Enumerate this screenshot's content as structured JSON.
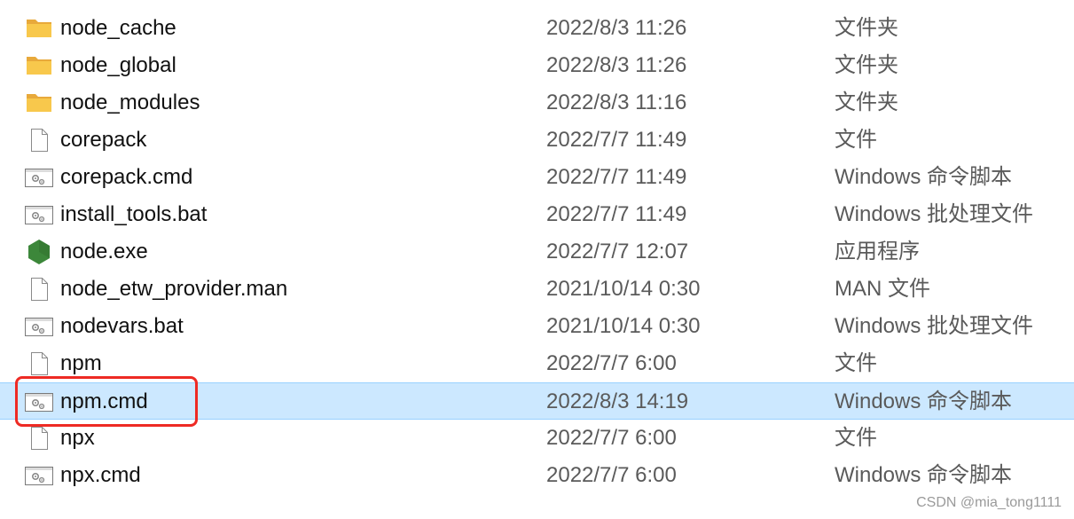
{
  "files": [
    {
      "name": "node_cache",
      "date": "2022/8/3 11:26",
      "type": "文件夹",
      "icon": "folder-icon"
    },
    {
      "name": "node_global",
      "date": "2022/8/3 11:26",
      "type": "文件夹",
      "icon": "folder-icon"
    },
    {
      "name": "node_modules",
      "date": "2022/8/3 11:16",
      "type": "文件夹",
      "icon": "folder-icon"
    },
    {
      "name": "corepack",
      "date": "2022/7/7 11:49",
      "type": "文件",
      "icon": "file-icon"
    },
    {
      "name": "corepack.cmd",
      "date": "2022/7/7 11:49",
      "type": "Windows 命令脚本",
      "icon": "script-icon"
    },
    {
      "name": "install_tools.bat",
      "date": "2022/7/7 11:49",
      "type": "Windows 批处理文件",
      "icon": "script-icon"
    },
    {
      "name": "node.exe",
      "date": "2022/7/7 12:07",
      "type": "应用程序",
      "icon": "nodejs-icon"
    },
    {
      "name": "node_etw_provider.man",
      "date": "2021/10/14 0:30",
      "type": "MAN 文件",
      "icon": "file-icon"
    },
    {
      "name": "nodevars.bat",
      "date": "2021/10/14 0:30",
      "type": "Windows 批处理文件",
      "icon": "script-icon"
    },
    {
      "name": "npm",
      "date": "2022/7/7 6:00",
      "type": "文件",
      "icon": "file-icon"
    },
    {
      "name": "npm.cmd",
      "date": "2022/8/3 14:19",
      "type": "Windows 命令脚本",
      "icon": "script-icon",
      "selected": true
    },
    {
      "name": "npx",
      "date": "2022/7/7 6:00",
      "type": "文件",
      "icon": "file-icon"
    },
    {
      "name": "npx.cmd",
      "date": "2022/7/7 6:00",
      "type": "Windows 命令脚本",
      "icon": "script-icon"
    }
  ],
  "colors": {
    "selection": "#cce8ff",
    "selection_border": "#99d1ff",
    "highlight": "#ee2a24",
    "folder": "#f8c84c",
    "nodejs": "#3c873a"
  },
  "watermark": "CSDN @mia_tong1111"
}
